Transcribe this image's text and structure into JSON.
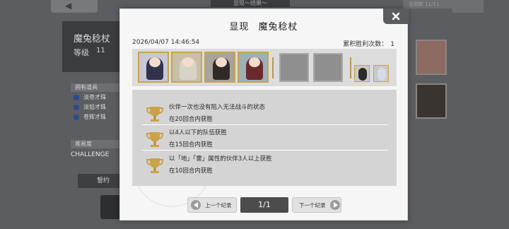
{
  "background": {
    "top_banner": "显现～结果～",
    "top_right": "击倒数 11/11",
    "character_name": "魔兔稔杖",
    "level_label": "等级",
    "level_value": "11",
    "section_gems_label": "拥有道具",
    "gems": [
      "淡苍才珠",
      "淡铅才珠",
      "苍辉才珠"
    ],
    "section_difficulty_label": "难易度",
    "difficulty": "CHALLENGE",
    "contract_button": "誓约"
  },
  "modal": {
    "title": "显现 魔兔稔杖",
    "date": "2026/04/07 14:46:54",
    "wins_label": "累积胜利次数：",
    "wins_value": "1",
    "team": {
      "portrait_icons": [
        "character-1-icon",
        "character-2-icon",
        "character-3-icon",
        "character-4-icon"
      ],
      "empty_slots": 2,
      "support_icons": [
        "support-1-icon",
        "support-2-icon"
      ]
    },
    "conditions": [
      {
        "title": "伙伴一次也没有陷入无法战斗的状态",
        "sub": "在20回合内获胜"
      },
      {
        "title": "以4人以下的队伍获胜",
        "sub": "在15回合内获胜"
      },
      {
        "title": "以「地」「雷」属性的伙伴3人以上获胜",
        "sub": "在10回合内获胜"
      }
    ],
    "nav": {
      "prev_label": "上一个纪录",
      "next_label": "下一个纪录",
      "page": "1/1"
    },
    "colors": {
      "trophy": "#c9a24a",
      "frame_gold": "#c7a44c",
      "page_indicator": "#4c4c4c",
      "close_button": "#5a5c60"
    }
  }
}
